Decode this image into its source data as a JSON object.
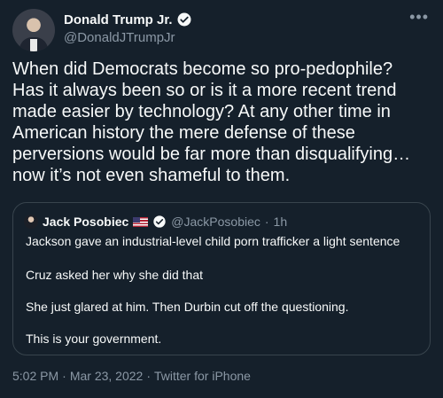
{
  "author": {
    "display_name": "Donald Trump Jr.",
    "handle": "@DonaldJTrumpJr"
  },
  "tweet": {
    "lines": [
      "When did Democrats become so pro-pedophile?",
      "Has it always been so or is it a more recent trend",
      "made easier by technology? At any other time in",
      "American history the mere defense of these",
      "perversions would be far more than disqualifying…",
      "now it’s not even shameful to them."
    ]
  },
  "quote": {
    "display_name": "Jack Posobiec",
    "flag": "🇺🇸",
    "handle": "@JackPosobiec",
    "separator": "·",
    "time": "1h",
    "lines": [
      "Jackson gave an industrial-level child porn trafficker a light sentence",
      "Cruz asked her why she did that",
      "She just glared at him. Then Durbin cut off the questioning.",
      "This is your government."
    ]
  },
  "meta": {
    "time": "5:02 PM",
    "date": "Mar 23, 2022",
    "separator": "·",
    "source": "Twitter for iPhone"
  },
  "icons": {
    "verified": "verified-badge-icon",
    "more": "more-options-icon"
  },
  "colors": {
    "background": "#15202b",
    "text": "#f7f9f9",
    "secondary": "#8b98a5",
    "border": "#38444d",
    "verified": "#1d9bf0"
  }
}
